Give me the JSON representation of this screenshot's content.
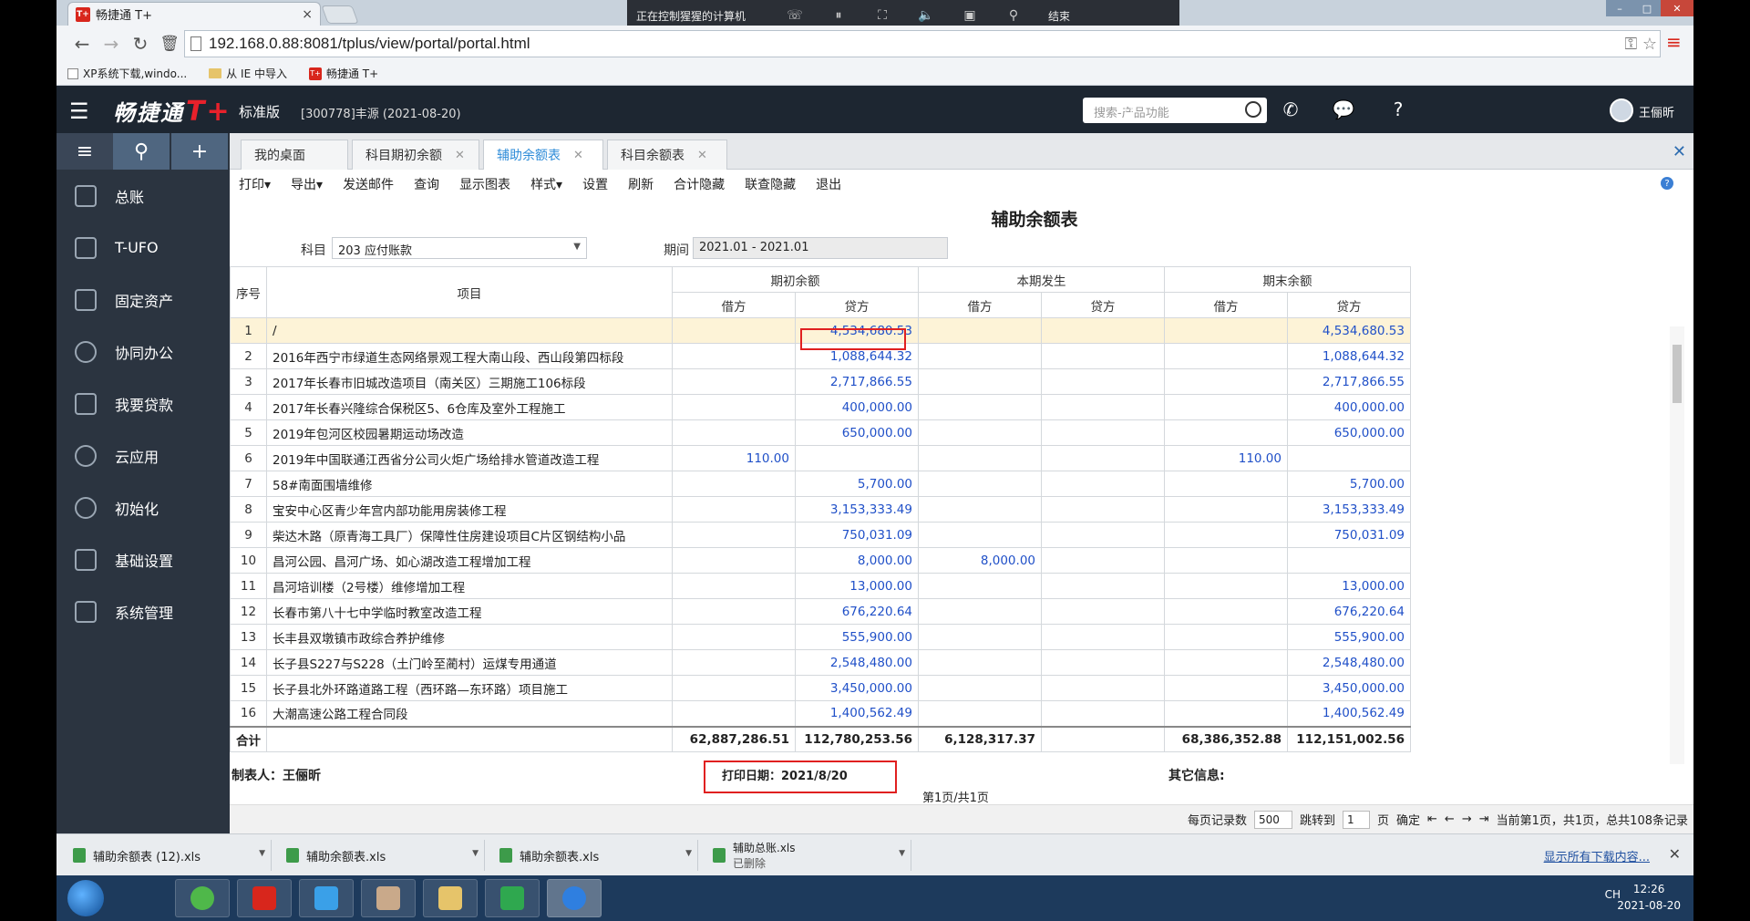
{
  "browser": {
    "tab_title": "畅捷通 T+",
    "tab_close": "×",
    "favicon_text": "T+",
    "url": "192.168.0.88:8081/tplus/view/portal/portal.html",
    "bookmarks": [
      "XP系统下载,windo...",
      "从 IE 中导入",
      "畅捷通 T+"
    ]
  },
  "remote_bar": {
    "status": "正在控制猩猩的计算机",
    "end_label": "结束"
  },
  "app": {
    "logo": "畅捷通",
    "logo_mark": "T+",
    "edition": "标准版",
    "account": "[300778]丰源   (2021-08-20)",
    "search_placeholder": "搜索-产品功能",
    "username": "王俪昕",
    "accent": "#2d8bd8",
    "header_bg": "#1d2631",
    "sidebar_bg": "#2b3440"
  },
  "sidebar": {
    "items": [
      {
        "label": "总账",
        "icon": "ledger-icon"
      },
      {
        "label": "T-UFO",
        "icon": "report-icon"
      },
      {
        "label": "固定资产",
        "icon": "asset-icon"
      },
      {
        "label": "协同办公",
        "icon": "office-icon"
      },
      {
        "label": "我要贷款",
        "icon": "loan-icon"
      },
      {
        "label": "云应用",
        "icon": "cloud-icon"
      },
      {
        "label": "初始化",
        "icon": "init-icon"
      },
      {
        "label": "基础设置",
        "icon": "settings-icon"
      },
      {
        "label": "系统管理",
        "icon": "system-icon"
      }
    ]
  },
  "tabs": [
    {
      "label": "我的桌面",
      "closable": false
    },
    {
      "label": "科目期初余额",
      "closable": true
    },
    {
      "label": "辅助余额表",
      "closable": true,
      "active": true
    },
    {
      "label": "科目余额表",
      "closable": true
    }
  ],
  "toolbar": [
    "打印▾",
    "导出▾",
    "发送邮件",
    "查询",
    "显示图表",
    "样式▾",
    "设置",
    "刷新",
    "合计隐藏",
    "联查隐藏",
    "退出"
  ],
  "report": {
    "title": "辅助余额表",
    "subject_label": "科目",
    "subject_value": "203 应付账款",
    "period_label": "期间",
    "period_value": "2021.01 - 2021.01",
    "headers": {
      "seq": "序号",
      "item": "项目",
      "opening": "期初余额",
      "current": "本期发生",
      "closing": "期末余额",
      "debit": "借方",
      "credit": "贷方"
    },
    "rows": [
      [
        "1",
        "/",
        "",
        "4,534,680.53",
        "",
        "",
        "",
        "4,534,680.53"
      ],
      [
        "2",
        "2016年西宁市绿道生态网络景观工程大南山段、西山段第四标段",
        "",
        "1,088,644.32",
        "",
        "",
        "",
        "1,088,644.32"
      ],
      [
        "3",
        "2017年长春市旧城改造项目（南关区）三期施工106标段",
        "",
        "2,717,866.55",
        "",
        "",
        "",
        "2,717,866.55"
      ],
      [
        "4",
        "2017年长春兴隆综合保税区5、6仓库及室外工程施工",
        "",
        "400,000.00",
        "",
        "",
        "",
        "400,000.00"
      ],
      [
        "5",
        "2019年包河区校园暑期运动场改造",
        "",
        "650,000.00",
        "",
        "",
        "",
        "650,000.00"
      ],
      [
        "6",
        "2019年中国联通江西省分公司火炬广场给排水管道改造工程",
        "110.00",
        "",
        "",
        "",
        "110.00",
        ""
      ],
      [
        "7",
        "58#南面围墙维修",
        "",
        "5,700.00",
        "",
        "",
        "",
        "5,700.00"
      ],
      [
        "8",
        "宝安中心区青少年宫内部功能用房装修工程",
        "",
        "3,153,333.49",
        "",
        "",
        "",
        "3,153,333.49"
      ],
      [
        "9",
        "柴达木路（原青海工具厂）保障性住房建设项目C片区钢结构小品",
        "",
        "750,031.09",
        "",
        "",
        "",
        "750,031.09"
      ],
      [
        "10",
        "昌河公园、昌河广场、如心湖改造工程增加工程",
        "",
        "8,000.00",
        "8,000.00",
        "",
        "",
        ""
      ],
      [
        "11",
        "昌河培训楼（2号楼）维修增加工程",
        "",
        "13,000.00",
        "",
        "",
        "",
        "13,000.00"
      ],
      [
        "12",
        "长春市第八十七中学临时教室改造工程",
        "",
        "676,220.64",
        "",
        "",
        "",
        "676,220.64"
      ],
      [
        "13",
        "长丰县双墩镇市政综合养护维修",
        "",
        "555,900.00",
        "",
        "",
        "",
        "555,900.00"
      ],
      [
        "14",
        "长子县S227与S228（土门岭至蔺村）运煤专用通道",
        "",
        "2,548,480.00",
        "",
        "",
        "",
        "2,548,480.00"
      ],
      [
        "15",
        "长子县北外环路道路工程（西环路—东环路）项目施工",
        "",
        "3,450,000.00",
        "",
        "",
        "",
        "3,450,000.00"
      ],
      [
        "16",
        "大潮高速公路工程合同段",
        "",
        "1,400,562.49",
        "",
        "",
        "",
        "1,400,562.49"
      ]
    ],
    "total": {
      "label": "合计",
      "opening_debit": "62,887,286.51",
      "opening_credit": "112,780,253.56",
      "current_debit": "6,128,317.37",
      "current_credit": "",
      "closing_debit": "68,386,352.88",
      "closing_credit": "112,151,002.56"
    },
    "maker": "制表人：王俪昕",
    "print_date": "打印日期：2021/8/20",
    "other_info": "其它信息:",
    "page_info": "第1页/共1页"
  },
  "pager": {
    "per_page_label": "每页记录数",
    "per_page": "500",
    "goto_label": "跳转到",
    "goto_page": "1",
    "page_unit": "页",
    "confirm": "确定",
    "status": "当前第1页，共1页，总共108条记录"
  },
  "downloads": {
    "items": [
      {
        "name": "辅助余额表 (12).xls",
        "sub": ""
      },
      {
        "name": "辅助余额表.xls",
        "sub": ""
      },
      {
        "name": "辅助余额表.xls",
        "sub": ""
      },
      {
        "name": "辅助总账.xls",
        "sub": "已删除"
      }
    ],
    "show_all": "显示所有下载内容..."
  },
  "taskbar": {
    "tray_lang": "CH",
    "time": "12:26",
    "date": "2021-08-20"
  }
}
